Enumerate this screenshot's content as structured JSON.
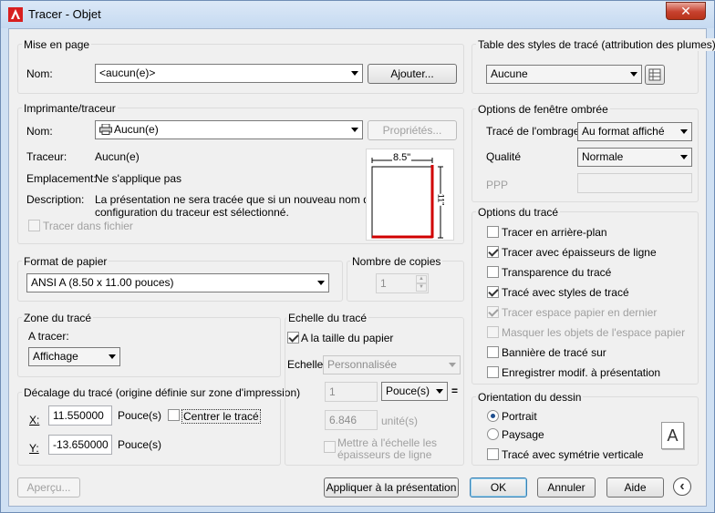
{
  "window": {
    "title": "Tracer - Objet",
    "close_symbol": "✕"
  },
  "page_setup": {
    "group_title": "Mise en page",
    "name_label": "Nom:",
    "name_value": "<aucun(e)>",
    "add_button": "Ajouter..."
  },
  "printer": {
    "group_title": "Imprimante/traceur",
    "name_label": "Nom:",
    "name_value": "Aucun(e)",
    "properties_button": "Propriétés...",
    "plotter_label": "Traceur:",
    "plotter_value": "Aucun(e)",
    "location_label": "Emplacement:",
    "location_value": "Ne s'applique pas",
    "description_label": "Description:",
    "description_line1": "La présentation ne sera tracée que si un nouveau nom de",
    "description_line2": "configuration du traceur est sélectionné.",
    "plot_to_file": "Tracer dans fichier",
    "preview_width": "8.5\"",
    "preview_height": "11\""
  },
  "paper": {
    "group_title": "Format de papier",
    "value": "ANSI A (8.50 x 11.00 pouces)"
  },
  "copies": {
    "group_title": "Nombre de copies",
    "value": "1"
  },
  "plot_area": {
    "group_title": "Zone du tracé",
    "what_label": "A tracer:",
    "what_value": "Affichage"
  },
  "plot_offset": {
    "group_title": "Décalage du tracé (origine définie sur zone d'impression)",
    "x_label": "X:",
    "x_value": "11.550000",
    "x_unit": "Pouce(s)",
    "y_label": "Y:",
    "y_value": "-13.650000",
    "y_unit": "Pouce(s)",
    "center_label": "Centrer le tracé"
  },
  "plot_scale": {
    "group_title": "Echelle du tracé",
    "fit_label": "A la taille du papier",
    "scale_label": "Echelle:",
    "scale_value": "Personnalisée",
    "value1": "1",
    "unit1": "Pouce(s)",
    "equals": "=",
    "value2": "6.846",
    "unit2": "unité(s)",
    "scale_lineweights_line1": "Mettre à l'échelle les",
    "scale_lineweights_line2": "épaisseurs de ligne"
  },
  "plot_style_table": {
    "group_title": "Table des styles de tracé (attribution des plumes)",
    "value": "Aucune"
  },
  "shaded_viewport": {
    "group_title": "Options de fenêtre ombrée",
    "shade_label": "Tracé de l'ombrage",
    "shade_value": "Au format affiché",
    "quality_label": "Qualité",
    "quality_value": "Normale",
    "dpi_label": "PPP",
    "dpi_value": ""
  },
  "plot_options": {
    "group_title": "Options du tracé",
    "items": [
      {
        "label": "Tracer en arrière-plan",
        "checked": false,
        "disabled": false
      },
      {
        "label": "Tracer avec épaisseurs de ligne",
        "checked": true,
        "disabled": false
      },
      {
        "label": "Transparence du tracé",
        "checked": false,
        "disabled": false
      },
      {
        "label": "Tracé avec styles de tracé",
        "checked": true,
        "disabled": false
      },
      {
        "label": "Tracer espace papier en dernier",
        "checked": true,
        "disabled": true
      },
      {
        "label": "Masquer les objets de l'espace papier",
        "checked": false,
        "disabled": true
      },
      {
        "label": "Bannière de tracé sur",
        "checked": false,
        "disabled": false
      },
      {
        "label": "Enregistrer modif. à présentation",
        "checked": false,
        "disabled": false
      }
    ]
  },
  "orientation": {
    "group_title": "Orientation du dessin",
    "portrait": "Portrait",
    "landscape": "Paysage",
    "upside_down": "Tracé avec symétrie verticale",
    "page_letter": "A"
  },
  "footer": {
    "preview_button": "Aperçu...",
    "apply_button": "Appliquer à la présentation",
    "ok_button": "OK",
    "cancel_button": "Annuler",
    "help_button": "Aide",
    "expand_symbol": "‹"
  },
  "colors": {
    "title_gradient_top": "#dbe8f7",
    "close_red": "#c7422f",
    "preview_red": "#d00000",
    "app_icon_red": "#d81f1f"
  }
}
